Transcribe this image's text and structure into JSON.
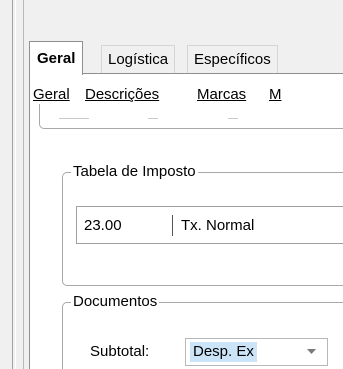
{
  "tabs": {
    "items": [
      {
        "label": "Geral",
        "active": true
      },
      {
        "label": "Logística",
        "active": false
      },
      {
        "label": "Específicos",
        "active": false
      }
    ]
  },
  "subtabs": {
    "items": [
      {
        "label": "Geral"
      },
      {
        "label": "Descrições"
      },
      {
        "label": "Marcas"
      },
      {
        "label": "M"
      }
    ]
  },
  "tabela_imposto": {
    "title": "Tabela de Imposto",
    "code": "23.00",
    "name": "Tx. Normal"
  },
  "documentos": {
    "title": "Documentos",
    "subtotal_label": "Subtotal:",
    "subtotal_value": "Desp. Ex"
  },
  "colors": {
    "selection": "#cce4f7",
    "border": "#a8a8a8",
    "background": "#f0f0f0"
  }
}
